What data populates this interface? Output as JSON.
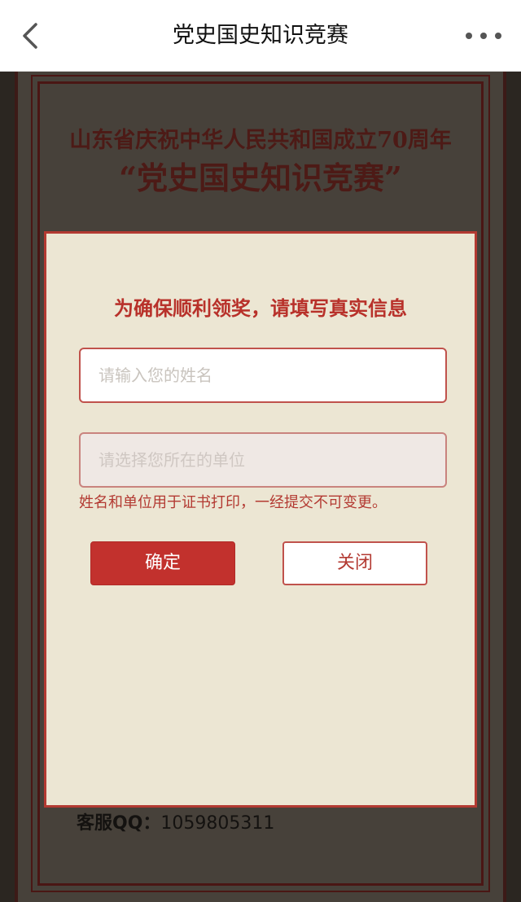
{
  "navbar": {
    "title": "党史国史知识竞赛",
    "back_icon": "chevron-left-icon",
    "more_icon": "more-dots-icon"
  },
  "background": {
    "title_line1": "山东省庆祝中华人民共和国成立70周年",
    "title_line2": "“党史国史知识竞赛”",
    "service_label": "客服QQ：",
    "service_qq": "1059805311"
  },
  "modal": {
    "heading": "为确保顺利领奖，请填写真实信息",
    "name_input": {
      "value": "",
      "placeholder": "请输入您的姓名"
    },
    "unit_select": {
      "value": "",
      "placeholder": "请选择您所在的单位"
    },
    "hint": "姓名和单位用于证书打印，一经提交不可变更。",
    "confirm_label": "确定",
    "close_label": "关闭"
  },
  "colors": {
    "accent": "#c2312d",
    "modal_bg": "#ece6d3",
    "navbar_bg": "#ffffff"
  }
}
